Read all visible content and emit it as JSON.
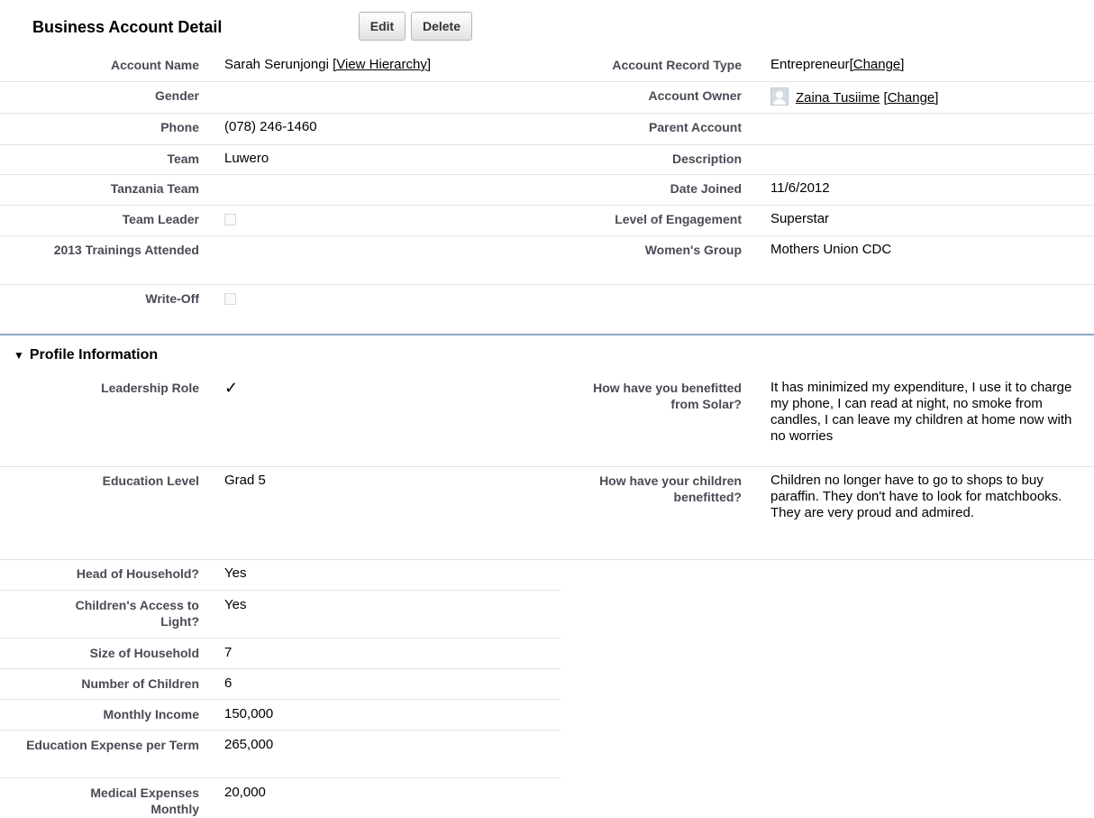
{
  "header": {
    "title": "Business Account Detail",
    "edit_label": "Edit",
    "delete_label": "Delete"
  },
  "detail": {
    "account_name": {
      "label": "Account Name",
      "value": "Sarah Serunjongi",
      "link": "[View Hierarchy]"
    },
    "account_record_type": {
      "label": "Account Record Type",
      "value": "Entrepreneur",
      "link": "[Change]"
    },
    "gender": {
      "label": "Gender",
      "value": ""
    },
    "account_owner": {
      "label": "Account Owner",
      "value": "Zaina Tusiime",
      "link": "[Change]"
    },
    "phone": {
      "label": "Phone",
      "value": "(078) 246-1460"
    },
    "parent_account": {
      "label": "Parent Account",
      "value": ""
    },
    "team": {
      "label": "Team",
      "value": "Luwero"
    },
    "description": {
      "label": "Description",
      "value": ""
    },
    "tanzania_team": {
      "label": "Tanzania Team",
      "value": ""
    },
    "date_joined": {
      "label": "Date Joined",
      "value": "11/6/2012"
    },
    "team_leader": {
      "label": "Team Leader",
      "checked": false
    },
    "level_of_engagement": {
      "label": "Level of Engagement",
      "value": "Superstar"
    },
    "trainings_2013": {
      "label": "2013 Trainings Attended",
      "value": ""
    },
    "womens_group": {
      "label": "Women's Group",
      "value": "Mothers Union CDC"
    },
    "write_off": {
      "label": "Write-Off",
      "checked": false
    }
  },
  "profile": {
    "section_title": "Profile Information",
    "toggle_icon": "▼",
    "leadership_role": {
      "label": "Leadership Role",
      "checked": true,
      "check_glyph": "✓"
    },
    "solar_benefit": {
      "label": "How have you benefitted from Solar?",
      "value": "It has minimized my expenditure, I use it to charge my phone, I can read at night, no smoke from candles, I can leave my children at home now with no worries"
    },
    "education_level": {
      "label": "Education Level",
      "value": "Grad 5"
    },
    "children_benefit": {
      "label": "How have your children benefitted?",
      "value": "Children no longer have to go to shops to buy paraffin. They don't have to look for matchbooks. They are very proud and admired."
    },
    "head_of_household": {
      "label": "Head of Household?",
      "value": "Yes"
    },
    "childrens_access_light": {
      "label": "Children's Access to Light?",
      "value": "Yes"
    },
    "size_of_household": {
      "label": "Size of Household",
      "value": "7"
    },
    "number_of_children": {
      "label": "Number of Children",
      "value": "6"
    },
    "monthly_income": {
      "label": "Monthly Income",
      "value": "150,000"
    },
    "education_expense": {
      "label": "Education Expense per Term",
      "value": "265,000"
    },
    "medical_expenses": {
      "label": "Medical Expenses Monthly",
      "value": "20,000"
    }
  }
}
